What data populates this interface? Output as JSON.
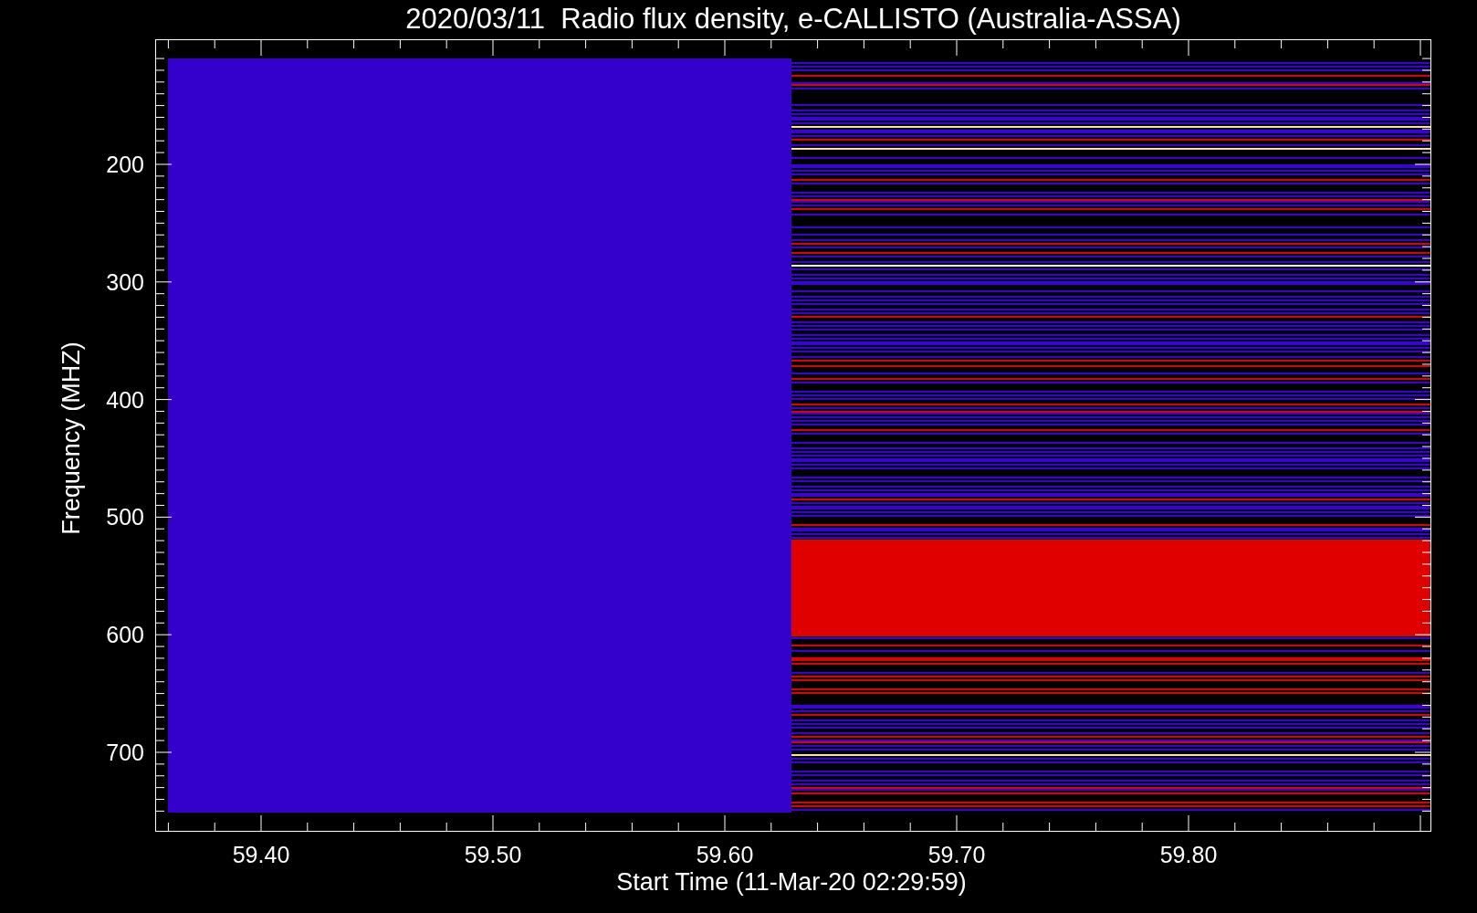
{
  "plot": {
    "title": "2020/03/11  Radio flux density, e-CALLISTO (Australia-ASSA)",
    "ylabel": "Frequency (MHZ)",
    "xlabel": "Start Time (11-Mar-20 02:29:59)",
    "y_tick_labels": [
      "200",
      "300",
      "400",
      "500",
      "600",
      "700"
    ],
    "x_tick_labels": [
      "59.40",
      "59.50",
      "59.60",
      "59.70",
      "59.80"
    ]
  }
}
